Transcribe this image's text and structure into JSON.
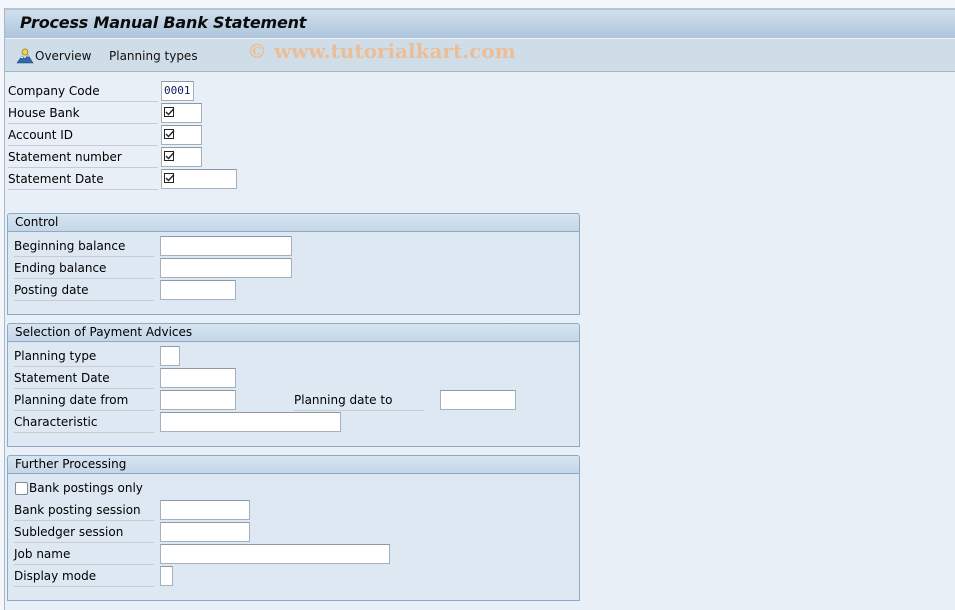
{
  "window": {
    "title": "Process Manual Bank Statement"
  },
  "toolbar": {
    "overview_label": "Overview",
    "overview_icon": "overview-icon",
    "planning_types_label": "Planning types",
    "watermark": "© www.tutorialkart.com"
  },
  "header_fields": {
    "company_code": {
      "label": "Company Code",
      "value": "0001"
    },
    "house_bank": {
      "label": "House Bank",
      "value": "",
      "required": true
    },
    "account_id": {
      "label": "Account ID",
      "value": "",
      "required": true
    },
    "statement_number": {
      "label": "Statement number",
      "value": "",
      "required": true
    },
    "statement_date": {
      "label": "Statement Date",
      "value": "",
      "required": true
    }
  },
  "control": {
    "title": "Control",
    "beginning_balance": {
      "label": "Beginning balance",
      "value": ""
    },
    "ending_balance": {
      "label": "Ending balance",
      "value": ""
    },
    "posting_date": {
      "label": "Posting date",
      "value": ""
    }
  },
  "selection": {
    "title": "Selection of Payment Advices",
    "planning_type": {
      "label": "Planning type",
      "value": ""
    },
    "statement_date": {
      "label": "Statement Date",
      "value": ""
    },
    "planning_date_from": {
      "label": "Planning date from",
      "value": ""
    },
    "planning_date_to": {
      "label": "Planning date to",
      "value": ""
    },
    "characteristic": {
      "label": "Characteristic",
      "value": ""
    }
  },
  "further": {
    "title": "Further Processing",
    "bank_postings_only": {
      "label": "Bank postings only",
      "checked": false
    },
    "bank_posting_session": {
      "label": "Bank posting session",
      "value": ""
    },
    "subledger_session": {
      "label": "Subledger session",
      "value": ""
    },
    "job_name": {
      "label": "Job name",
      "value": ""
    },
    "display_mode": {
      "label": "Display mode",
      "value": ""
    }
  }
}
